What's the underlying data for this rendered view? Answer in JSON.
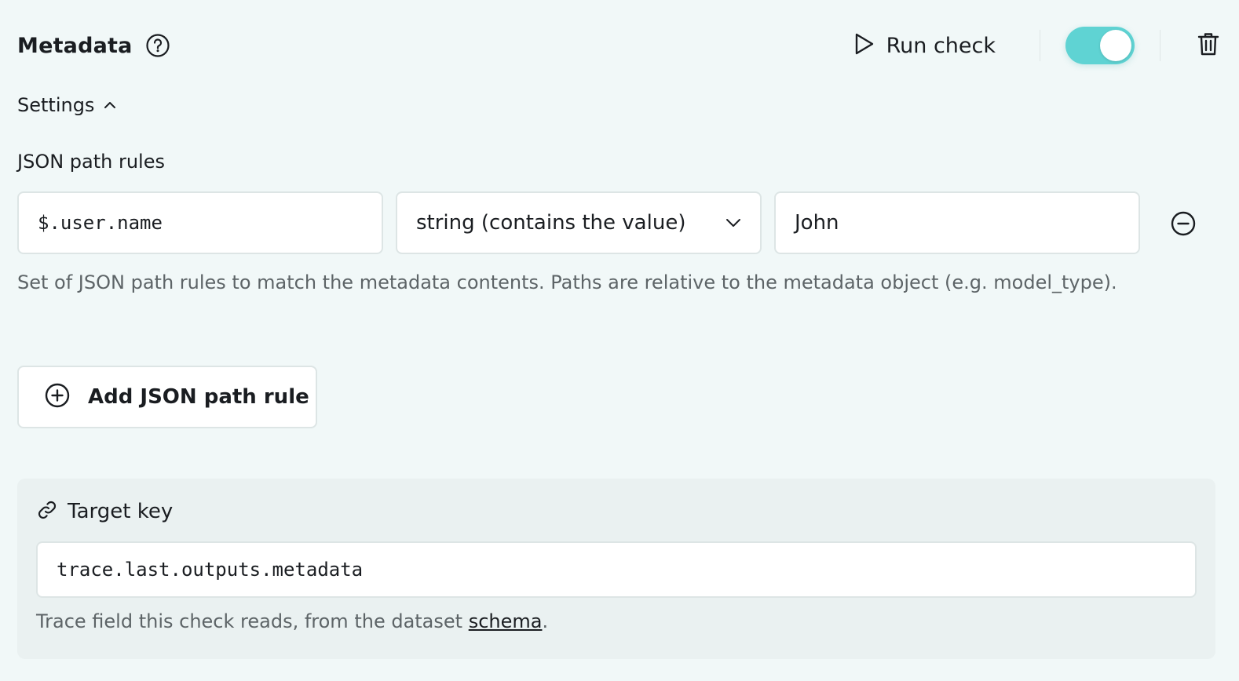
{
  "header": {
    "title": "Metadata",
    "run_check_label": "Run check",
    "toggle_on": true
  },
  "settings": {
    "label": "Settings"
  },
  "rules_section": {
    "label": "JSON path rules",
    "rules": [
      {
        "path": "$.user.name",
        "match_type": "string (contains the value)",
        "value": "John"
      }
    ],
    "helper": "Set of JSON path rules to match the metadata contents. Paths are relative to the metadata object (e.g. model_type).",
    "add_label": "Add JSON path rule"
  },
  "target": {
    "label": "Target key",
    "value": "trace.last.outputs.metadata",
    "helper_prefix": "Trace field this check reads, from the dataset ",
    "helper_link": "schema",
    "helper_suffix": "."
  },
  "colors": {
    "background": "#f1f8f8",
    "toggle_active": "#5fd3d3",
    "card": "#eaf1f1"
  }
}
